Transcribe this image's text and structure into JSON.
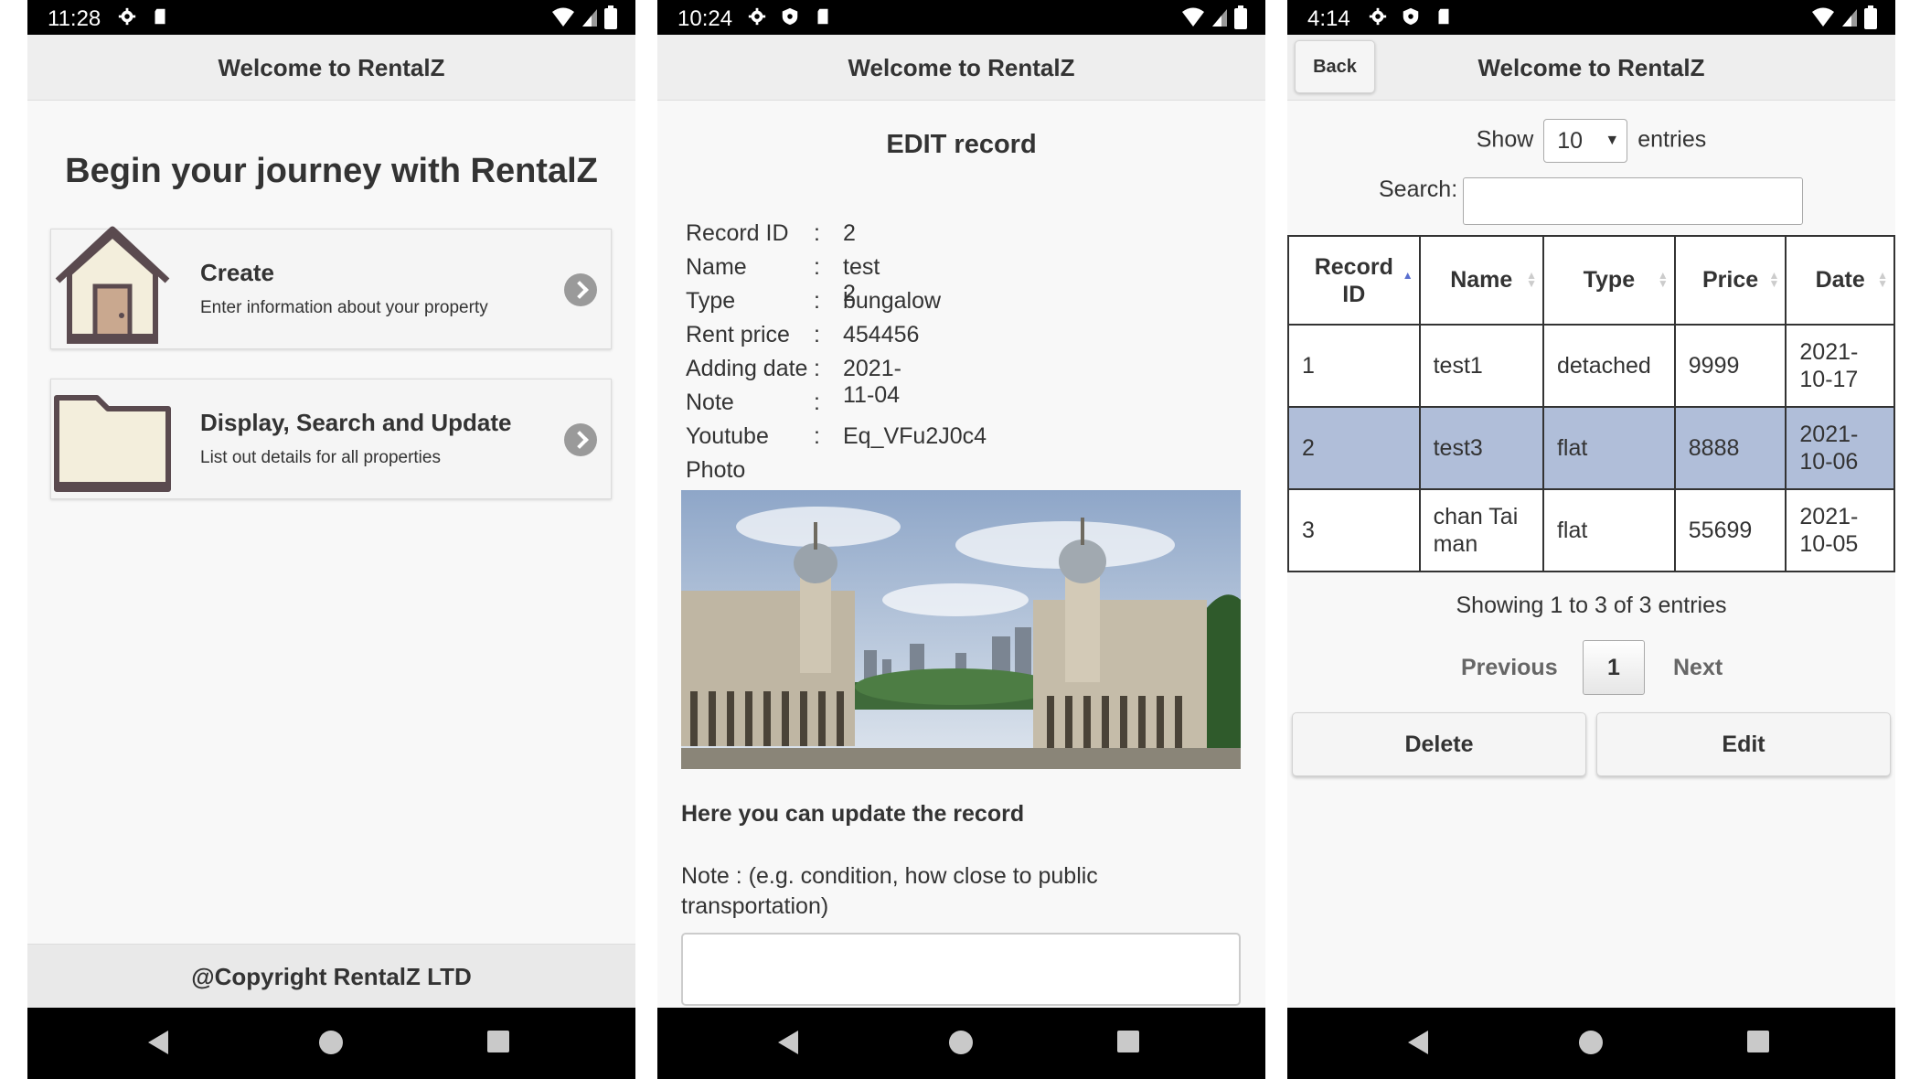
{
  "screens": {
    "home": {
      "time": "11:28",
      "header": "Welcome to RentalZ",
      "title": "Begin your journey with RentalZ",
      "cards": [
        {
          "title": "Create",
          "subtitle": "Enter information about your property"
        },
        {
          "title": "Display, Search and Update",
          "subtitle": "List out details for all properties"
        }
      ],
      "footer": "@Copyright RentalZ LTD"
    },
    "edit": {
      "time": "10:24",
      "header": "Welcome to RentalZ",
      "title": "EDIT record",
      "fields": [
        {
          "label": "Record ID",
          "value": "2"
        },
        {
          "label": "Name",
          "value": "test 2"
        },
        {
          "label": "Type",
          "value": "bungalow"
        },
        {
          "label": "Rent price",
          "value": "454456"
        },
        {
          "label": "Adding date",
          "value": "2021-11-04"
        },
        {
          "label": "Note",
          "value": ""
        },
        {
          "label": "Youtube",
          "value": "Eq_VFu2J0c4"
        },
        {
          "label": "Photo",
          "value": ""
        }
      ],
      "colon": ":",
      "update_heading": "Here you can update the record",
      "note_label": "Note : (e.g. condition, how close to public transportation)"
    },
    "list": {
      "time": "4:14",
      "back_label": "Back",
      "header": "Welcome to RentalZ",
      "show_label": "Show",
      "entries_value": "10",
      "entries_label": "entries",
      "search_label": "Search:",
      "columns": [
        "Record ID",
        "Name",
        "Type",
        "Price",
        "Date"
      ],
      "rows": [
        {
          "id": "1",
          "name": "test1",
          "type": "detached",
          "price": "9999",
          "date": "2021-10-17"
        },
        {
          "id": "2",
          "name": "test3",
          "type": "flat",
          "price": "8888",
          "date": "2021-10-06"
        },
        {
          "id": "3",
          "name": "chan Tai man",
          "type": "flat",
          "price": "55699",
          "date": "2021-10-05"
        }
      ],
      "showing": "Showing 1 to 3 of 3 entries",
      "prev_label": "Previous",
      "page": "1",
      "next_label": "Next",
      "delete_label": "Delete",
      "edit_label": "Edit"
    }
  },
  "colors": {
    "selected_row": "#b0bed9",
    "status_bar": "#000000",
    "header_bg": "#eeeeee",
    "icon_dark": "#5a4a4f",
    "icon_fill": "#f3eedc"
  }
}
